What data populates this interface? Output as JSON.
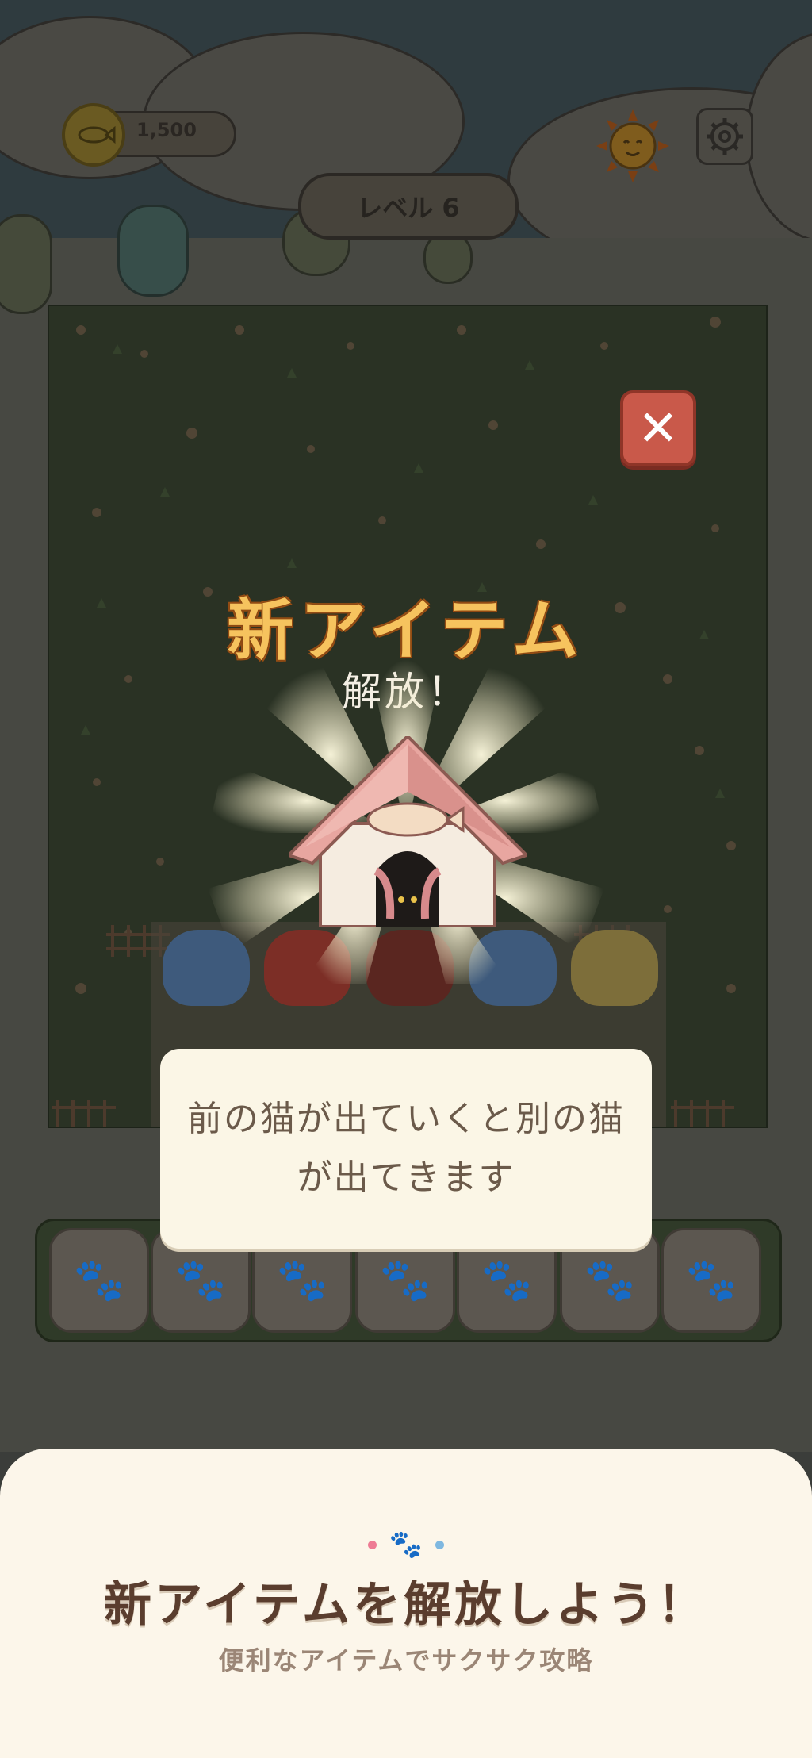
{
  "hud": {
    "coins": "1,500",
    "level": "レベル 6"
  },
  "overlay": {
    "title": "新アイテム",
    "subtitle": "解放！",
    "tooltip_line1": "前の猫が出ていくと別の猫",
    "tooltip_line2": "が出てきます",
    "close_icon": "close-icon",
    "item_icon": "cat-house-icon"
  },
  "tray": {
    "slot_icon": "paw-icon",
    "slots": 7
  },
  "cats": [
    {
      "color": "#3e5a7c"
    },
    {
      "color": "#7c2e26"
    },
    {
      "color": "#6a2a24"
    },
    {
      "color": "#3e5a7c"
    },
    {
      "color": "#7d6e3a"
    }
  ],
  "promo": {
    "title": "新アイテムを解放しよう！",
    "subtitle": "便利なアイテムでサクサク攻略",
    "accent_pink": "#ee7b94",
    "accent_blue": "#7fb8e0"
  }
}
